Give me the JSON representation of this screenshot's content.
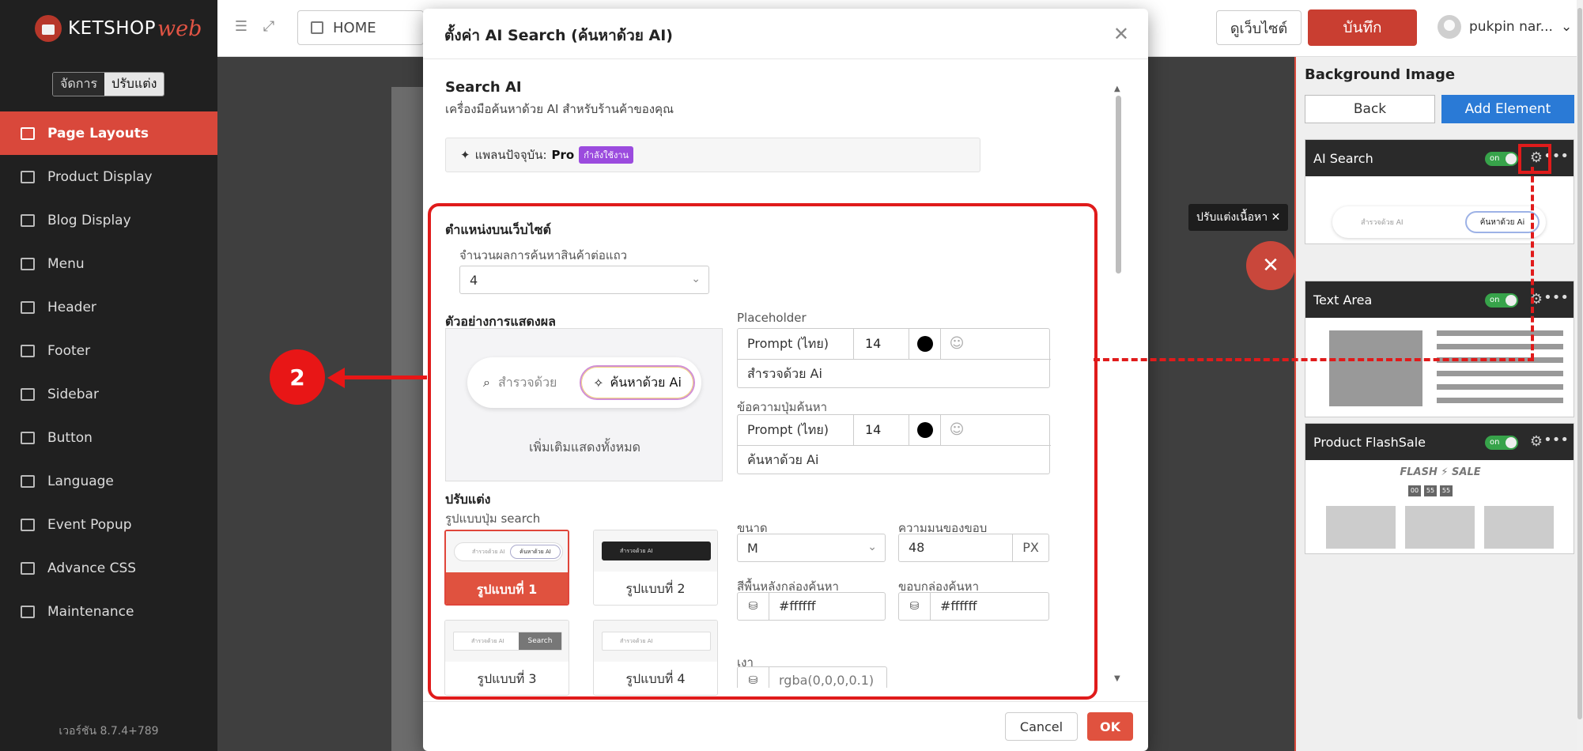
{
  "brand": {
    "name": "KETSHOP",
    "suffix": "web"
  },
  "mode_toggle": {
    "manage": "จัดการ",
    "customize": "ปรับแต่ง"
  },
  "sidebar": {
    "items": [
      {
        "label": "Page Layouts",
        "active": true
      },
      {
        "label": "Product Display"
      },
      {
        "label": "Blog Display"
      },
      {
        "label": "Menu"
      },
      {
        "label": "Header"
      },
      {
        "label": "Footer"
      },
      {
        "label": "Sidebar"
      },
      {
        "label": "Button"
      },
      {
        "label": "Language"
      },
      {
        "label": "Event Popup"
      },
      {
        "label": "Advance CSS"
      },
      {
        "label": "Maintenance"
      }
    ],
    "version": "เวอร์ชัน 8.7.4+789"
  },
  "topbar": {
    "breadcrumb": "HOME",
    "view_site": "ดูเว็บไซต์",
    "save": "บันทึก",
    "user": "pukpin nar..."
  },
  "canvas": {
    "edit_tooltip": "ปรับแต่งเนื้อหา",
    "close_symbol": "✕"
  },
  "right_panel": {
    "title": "Background Image",
    "back": "Back",
    "add_element": "Add Element",
    "cards": [
      {
        "title": "AI Search",
        "toggle": "on",
        "preview_placeholder": "สำรวจด้วย AI",
        "preview_button": "ค้นหาด้วย Ai"
      },
      {
        "title": "Text Area",
        "toggle": "on"
      },
      {
        "title": "Product FlashSale",
        "toggle": "on",
        "preview_heading": "FLASH ⚡ SALE",
        "timer": [
          "00",
          "55",
          "55"
        ]
      }
    ]
  },
  "modal": {
    "title": "ตั้งค่า AI Search (ค้นหาด้วย AI)",
    "section_title": "Search AI",
    "section_subtitle": "เครื่องมือค้นหาด้วย AI สำหรับร้านค้าของคุณ",
    "plan_label": "แพลนปัจจุบัน:",
    "plan_value": "Pro",
    "plan_badge": "กำลังใช้งาน",
    "position": {
      "heading": "ตำแหน่งบนเว็บไซต์",
      "per_row_label": "จำนวนผลการค้นหาสินค้าต่อแถว",
      "per_row_value": "4"
    },
    "preview": {
      "heading": "ตัวอย่างการแสดงผล",
      "placeholder": "สำรวจด้วย",
      "button": "ค้นหาด้วย Ai",
      "show_more": "เพิ่มเติมแสดงทั้งหมด"
    },
    "placeholder_field": {
      "label": "Placeholder",
      "font": "Prompt (ไทย)",
      "size": "14",
      "text": "สำรวจด้วย Ai"
    },
    "button_field": {
      "label": "ข้อความปุ่มค้นหา",
      "font": "Prompt (ไทย)",
      "size": "14",
      "text": "ค้นหาด้วย Ai"
    },
    "customize": {
      "heading": "ปรับแต่ง",
      "style_label": "รูปแบบปุ่ม search",
      "styles": [
        {
          "label": "รูปแบบที่ 1",
          "active": true,
          "mini_placeholder": "สำรวจด้วย AI",
          "mini_button": "ค้นหาด้วย AI"
        },
        {
          "label": "รูปแบบที่ 2",
          "mini_placeholder": "สำรวจด้วย AI"
        },
        {
          "label": "รูปแบบที่ 3",
          "mini_placeholder": "สำรวจด้วย AI",
          "mini_button": "Search"
        },
        {
          "label": "รูปแบบที่ 4",
          "mini_placeholder": "สำรวจด้วย AI"
        }
      ],
      "size_label": "ขนาด",
      "size_value": "M",
      "radius_label": "ความมนของขอบ",
      "radius_value": "48",
      "radius_unit": "PX",
      "bg_label": "สีพื้นหลังกล่องค้นหา",
      "bg_value": "#ffffff",
      "border_label": "ขอบกล่องค้นหา",
      "border_value": "#ffffff",
      "shadow_label": "เงา",
      "shadow_value": "rgba(0,0,0,0.1)"
    },
    "cancel": "Cancel",
    "ok": "OK"
  },
  "annotation": {
    "step": "2"
  }
}
